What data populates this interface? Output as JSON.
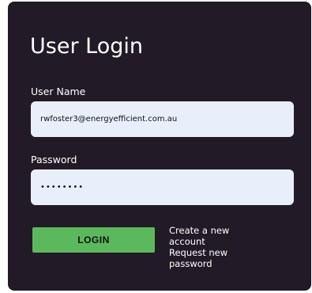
{
  "login": {
    "title": "User Login",
    "username_label": "User Name",
    "username_value": "rwfoster3@energyefficient.com.au",
    "password_label": "Password",
    "password_value": "••••••••",
    "login_button": "LOGIN",
    "create_account_link": "Create a new account",
    "request_password_link": "Request new password"
  },
  "colors": {
    "panel_background": "#221a26",
    "input_background": "#e8effb",
    "button_green": "#5cb85c",
    "text": "#ffffff"
  }
}
